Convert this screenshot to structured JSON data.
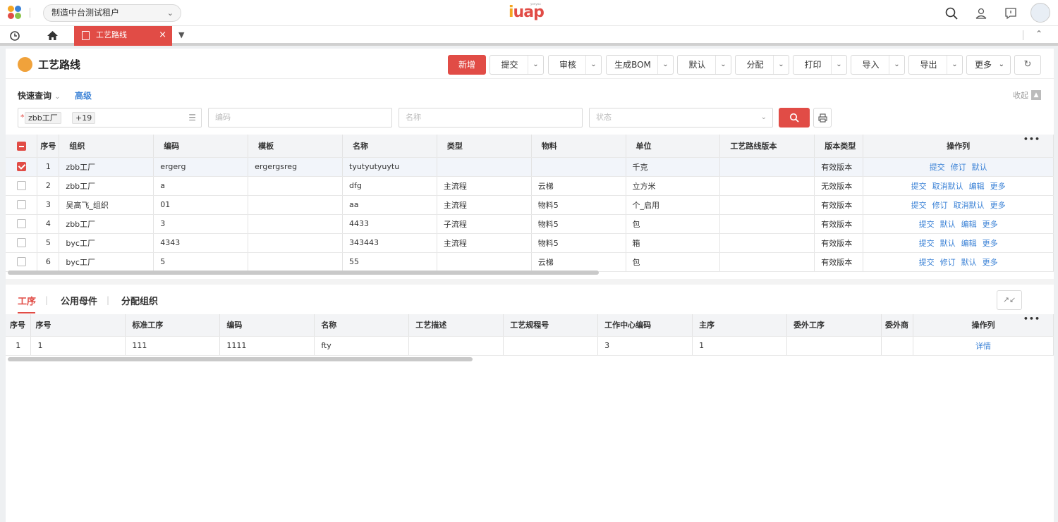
{
  "header": {
    "tenant": "制造中台测试租户",
    "brand": "iuap",
    "brand_sub": "yonyou",
    "brand_colors": [
      "#f5a623",
      "#e14c46",
      "#3b82d6"
    ]
  },
  "tabs": {
    "active": "工艺路线"
  },
  "page": {
    "title": "工艺路线",
    "toolbar": {
      "add": "新增",
      "submit": "提交",
      "audit": "审核",
      "gen_bom": "生成BOM",
      "default": "默认",
      "assign": "分配",
      "print": "打印",
      "import": "导入",
      "export": "导出",
      "more": "更多"
    }
  },
  "query": {
    "quick": "快速查询",
    "advanced": "高级",
    "collapse": "收起",
    "org_required": "*",
    "org_chip": "zbb工厂",
    "org_more": "+19",
    "code_placeholder": "编码",
    "name_placeholder": "名称",
    "status_placeholder": "状态"
  },
  "grid": {
    "columns": [
      "序号",
      "组织",
      "编码",
      "模板",
      "名称",
      "类型",
      "物料",
      "单位",
      "工艺路线版本",
      "版本类型",
      "操作列"
    ],
    "more": "•••",
    "rows": [
      {
        "checked": true,
        "no": "1",
        "org": "zbb工厂",
        "code": "ergerg",
        "tpl": "ergergsreg",
        "name": "tyutyutyuytu",
        "type": "",
        "mat": "",
        "unit": "千克",
        "ver": "",
        "vtype": "有效版本",
        "ops": [
          "提交",
          "修订",
          "默认"
        ]
      },
      {
        "checked": false,
        "no": "2",
        "org": "zbb工厂",
        "code": "a",
        "tpl": "",
        "name": "dfg",
        "type": "主流程",
        "mat": "云梯",
        "unit": "立方米",
        "ver": "",
        "vtype": "无效版本",
        "ops": [
          "提交",
          "取消默认",
          "编辑",
          "更多"
        ]
      },
      {
        "checked": false,
        "no": "3",
        "org": "吴高飞_组织",
        "code": "01",
        "tpl": "",
        "name": "aa",
        "type": "主流程",
        "mat": "物料5",
        "unit": "个_启用",
        "ver": "",
        "vtype": "有效版本",
        "ops": [
          "提交",
          "修订",
          "取消默认",
          "更多"
        ]
      },
      {
        "checked": false,
        "no": "4",
        "org": "zbb工厂",
        "code": "3",
        "tpl": "",
        "name": "4433",
        "type": "子流程",
        "mat": "物料5",
        "unit": "包",
        "ver": "",
        "vtype": "有效版本",
        "ops": [
          "提交",
          "默认",
          "编辑",
          "更多"
        ]
      },
      {
        "checked": false,
        "no": "5",
        "org": "byc工厂",
        "code": "4343",
        "tpl": "",
        "name": "343443",
        "type": "主流程",
        "mat": "物料5",
        "unit": "箱",
        "ver": "",
        "vtype": "有效版本",
        "ops": [
          "提交",
          "默认",
          "编辑",
          "更多"
        ]
      },
      {
        "checked": false,
        "no": "6",
        "org": "byc工厂",
        "code": "5",
        "tpl": "",
        "name": "55",
        "type": "",
        "mat": "云梯",
        "unit": "包",
        "ver": "",
        "vtype": "有效版本",
        "ops": [
          "提交",
          "修订",
          "默认",
          "更多"
        ]
      }
    ]
  },
  "subtabs": [
    "工序",
    "公用母件",
    "分配组织"
  ],
  "subgrid": {
    "columns": [
      "序号",
      "序号",
      "标准工序",
      "编码",
      "名称",
      "工艺描述",
      "工艺规程号",
      "工作中心编码",
      "主序",
      "委外工序",
      "委外商",
      "操作列"
    ],
    "rows": [
      {
        "idx": "1",
        "no": "1",
        "std": "111",
        "code": "1111",
        "name": "fty",
        "desc": "",
        "spec": "",
        "wc": "3",
        "main": "1",
        "outs": "",
        "vendor": "",
        "op": "详情"
      }
    ]
  }
}
